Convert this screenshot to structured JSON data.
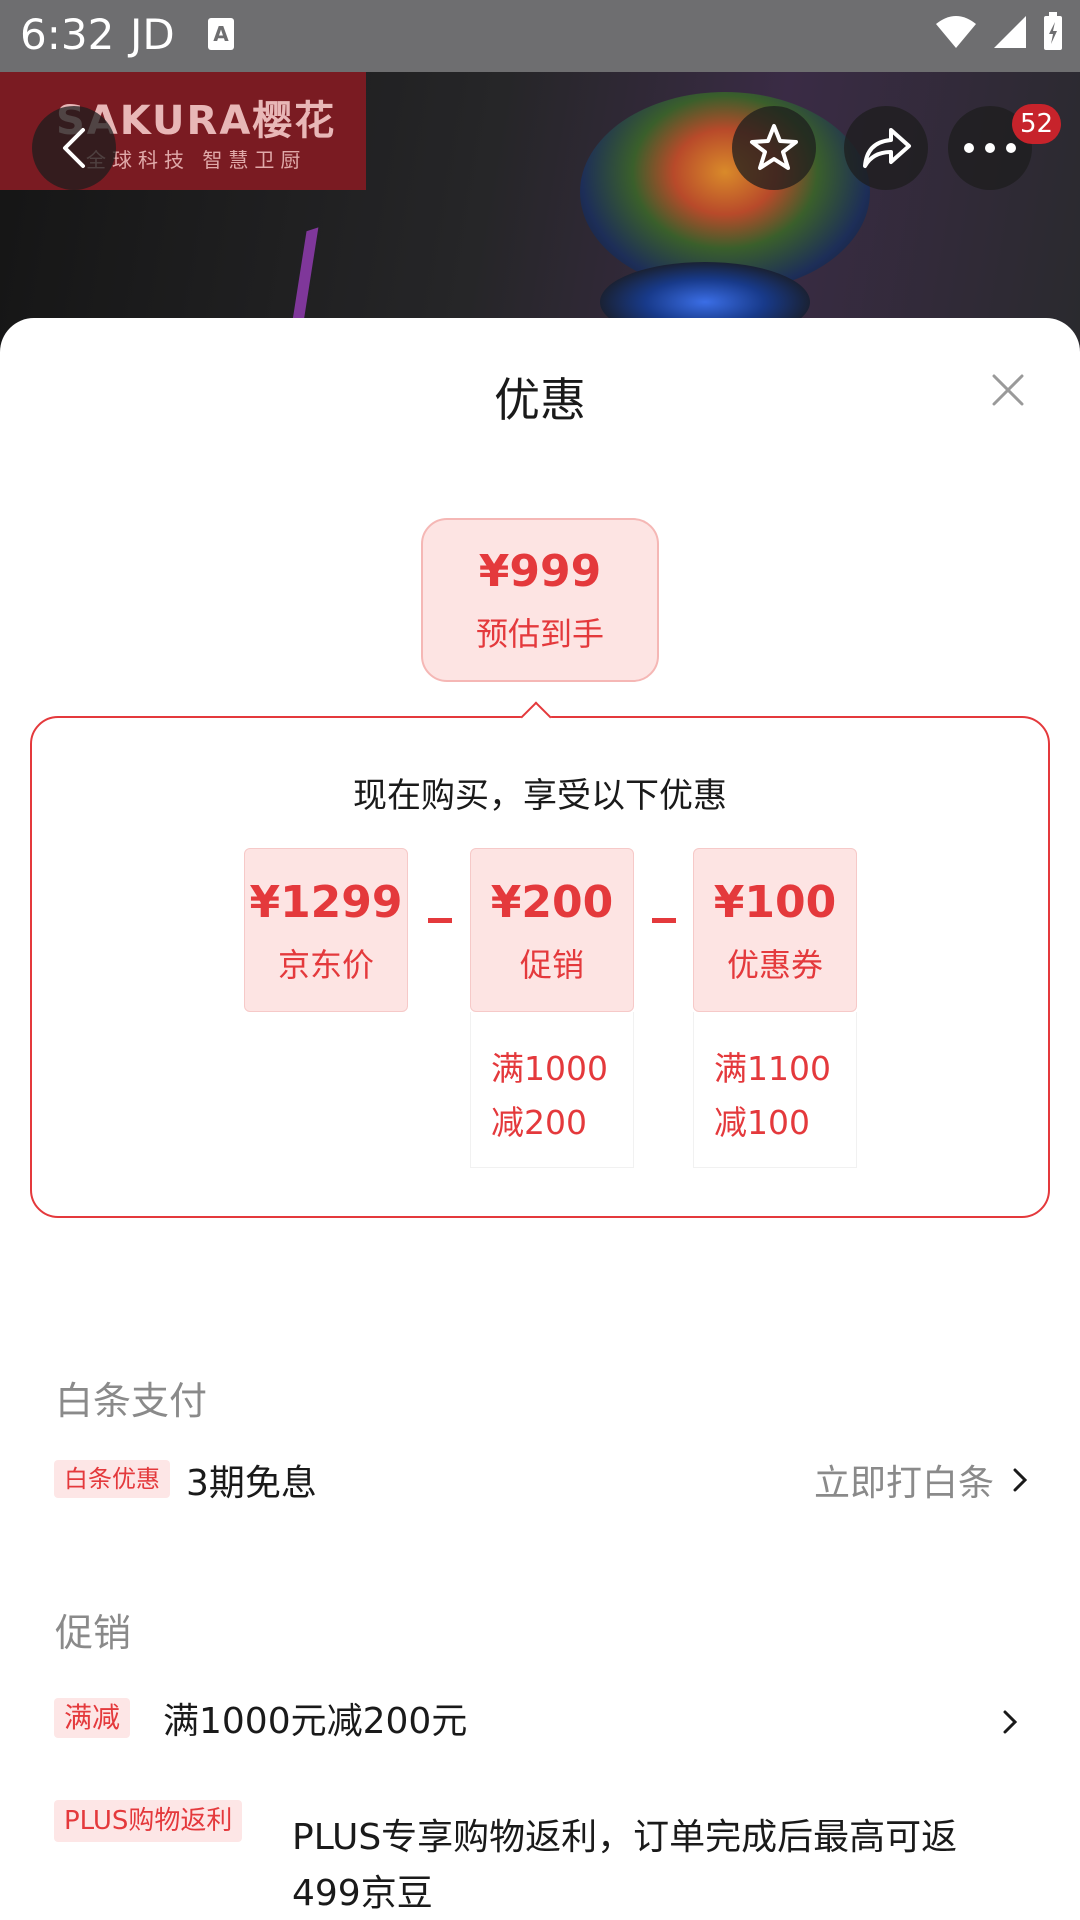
{
  "status_bar": {
    "time": "6:32",
    "carrier": "JD",
    "notification_letter": "A"
  },
  "header": {
    "brand_logo_text": "SAKURA樱花",
    "brand_slogan": "全球科技 智慧卫厨",
    "cart_badge": "52"
  },
  "sheet": {
    "title": "优惠",
    "estimate": {
      "price": "¥999",
      "label": "预估到手"
    },
    "calc": {
      "title": "现在购买，享受以下优惠",
      "items": [
        {
          "amount": "¥1299",
          "label": "京东价"
        },
        {
          "amount": "¥200",
          "label": "促销",
          "rule_line1": "满1000",
          "rule_line2": "减200"
        },
        {
          "amount": "¥100",
          "label": "优惠券",
          "rule_line1": "满1100",
          "rule_line2": "减100"
        }
      ]
    },
    "baitiao": {
      "section_title": "白条支付",
      "tag": "白条优惠",
      "text": "3期免息",
      "action": "立即打白条"
    },
    "promo": {
      "section_title": "促销",
      "rows": [
        {
          "tag": "满减",
          "text": "满1000元减200元"
        },
        {
          "tag": "PLUS购物返利",
          "text_line1": "PLUS专享购物返利，订单完成后最高可返",
          "text_line2": "499京豆"
        }
      ]
    }
  },
  "colors": {
    "accent_red": "#e4393c",
    "tag_bg": "#fde6e6",
    "muted_text": "#8a8a8a"
  }
}
